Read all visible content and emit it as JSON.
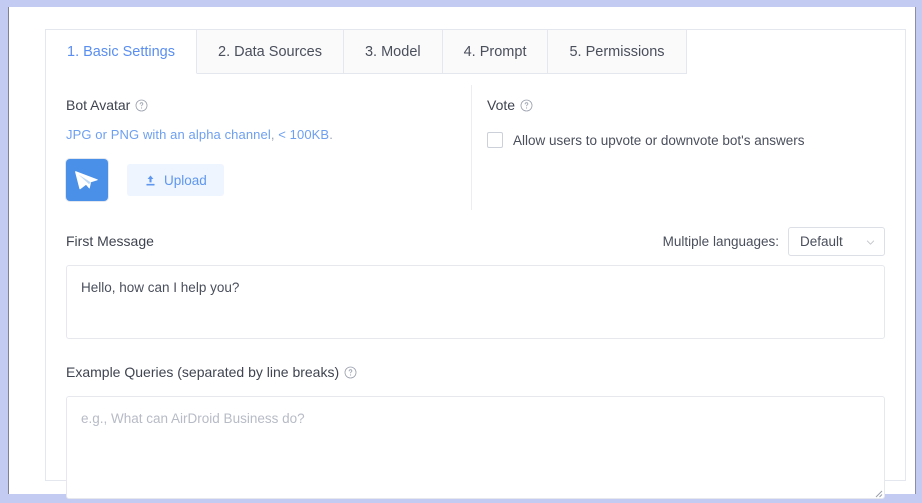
{
  "tabs": [
    {
      "label": "1. Basic Settings",
      "active": true
    },
    {
      "label": "2. Data Sources",
      "active": false
    },
    {
      "label": "3. Model",
      "active": false
    },
    {
      "label": "4. Prompt",
      "active": false
    },
    {
      "label": "5. Permissions",
      "active": false
    }
  ],
  "bot_avatar": {
    "label": "Bot Avatar",
    "hint_main": "JPG or PNG with an alpha channel",
    "hint_sep": ",",
    "hint_size": "< 100KB",
    "hint_end": ".",
    "upload_label": "Upload",
    "avatar_icon": "paper-plane-icon",
    "upload_icon": "upload-icon",
    "help_icon": "help-circle-icon"
  },
  "vote": {
    "label": "Vote",
    "help_icon": "help-circle-icon",
    "checkbox_label": "Allow users to upvote or downvote bot's answers",
    "checked": false
  },
  "first_message": {
    "label": "First Message",
    "lang_label": "Multiple languages:",
    "lang_value": "Default",
    "chevron_icon": "chevron-down-icon",
    "value": "Hello, how can I help you?",
    "placeholder": ""
  },
  "example_queries": {
    "label": "Example Queries (separated by line breaks)",
    "help_icon": "help-circle-icon",
    "value": "",
    "placeholder": "e.g., What can AirDroid Business do?"
  },
  "colors": {
    "accent": "#5a8ef0",
    "avatar_bg": "#4a90e8",
    "upload_bg": "#eef5ff",
    "page_bg": "#c3cbf2",
    "border": "#e4e7ed"
  }
}
